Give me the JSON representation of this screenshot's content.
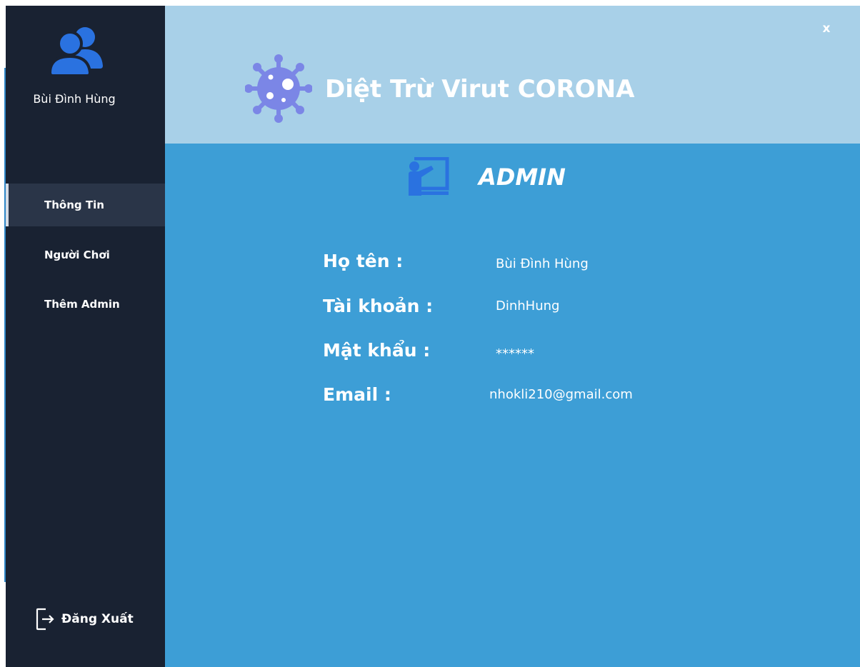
{
  "sidebar": {
    "user_name": "Bùi Đình Hùng",
    "items": [
      {
        "label": "Thông Tin",
        "active": true
      },
      {
        "label": "Người Chơi",
        "active": false
      },
      {
        "label": "Thêm Admin",
        "active": false
      }
    ],
    "logout_label": "Đăng Xuất"
  },
  "header": {
    "title": "Diệt Trừ Virut CORONA",
    "close_label": "x"
  },
  "main": {
    "role_title": "ADMIN",
    "fields": [
      {
        "label": "Họ tên :",
        "value": "Bùi Đình Hùng"
      },
      {
        "label": "Tài khoản :",
        "value": "DinhHung"
      },
      {
        "label": "Mật khẩu :",
        "value": "******"
      },
      {
        "label": "Email :",
        "value": "nhokli210@gmail.com"
      }
    ]
  },
  "colors": {
    "sidebar_bg": "#192232",
    "sidebar_active_bg": "#2a3548",
    "header_bg": "#a8d0e8",
    "content_bg": "#3d9ed6",
    "accent_blue": "#2a72e0",
    "virus_purple": "#7b86e6"
  },
  "icons": {
    "avatar": "users-icon",
    "virus": "virus-icon",
    "role": "teacher-board-icon",
    "logout": "logout-icon"
  }
}
